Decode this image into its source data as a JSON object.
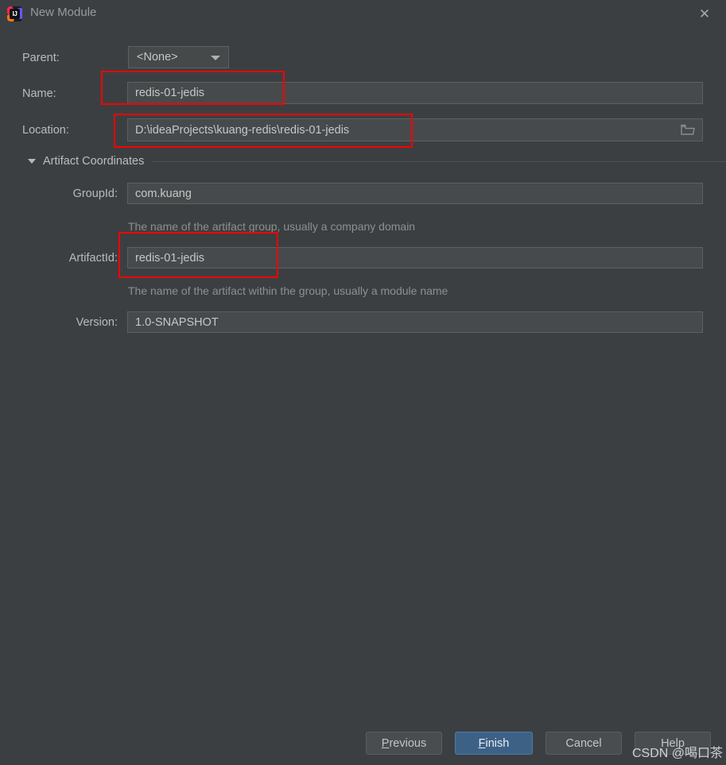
{
  "window": {
    "title": "New Module",
    "logo_text": "IJ",
    "close_label": "✕"
  },
  "form": {
    "parent": {
      "label": "Parent:",
      "value": "<None>",
      "options": [
        "<None>"
      ]
    },
    "name": {
      "label": "Name:",
      "value": "redis-01-jedis"
    },
    "location": {
      "label": "Location:",
      "value": "D:\\ideaProjects\\kuang-redis\\redis-01-jedis",
      "browse_icon": "folder-icon"
    }
  },
  "artifact_section": {
    "title": "Artifact Coordinates",
    "expanded": true,
    "group_id": {
      "label": "GroupId:",
      "value": "com.kuang",
      "hint": "The name of the artifact group, usually a company domain"
    },
    "artifact_id": {
      "label": "ArtifactId:",
      "value": "redis-01-jedis",
      "hint": "The name of the artifact within the group, usually a module name"
    },
    "version": {
      "label": "Version:",
      "value": "1.0-SNAPSHOT"
    }
  },
  "buttons": {
    "previous": {
      "mnemonic": "P",
      "rest": "revious"
    },
    "finish": {
      "mnemonic": "F",
      "rest": "inish"
    },
    "cancel": "Cancel",
    "help": "Help"
  },
  "watermark": "CSDN @喝口茶",
  "colors": {
    "dialog_background": "#3c3f41",
    "field_background": "#474a4c",
    "primary_button": "#3d6185",
    "annotation": "#fb0000",
    "text": "#bbbbbb",
    "hint_text": "#8d8f90"
  }
}
